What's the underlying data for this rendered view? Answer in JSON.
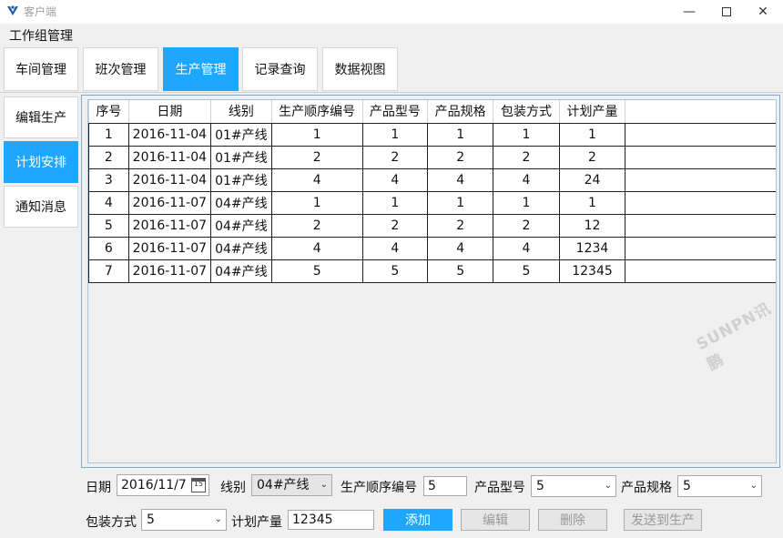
{
  "window": {
    "title": "客户端"
  },
  "header": {
    "title": "工作组管理"
  },
  "top_tabs": [
    {
      "label": "车间管理",
      "active": false
    },
    {
      "label": "班次管理",
      "active": false
    },
    {
      "label": "生产管理",
      "active": true
    },
    {
      "label": "记录查询",
      "active": false
    },
    {
      "label": "数据视图",
      "active": false
    }
  ],
  "side_nav": [
    {
      "label": "编辑生产",
      "active": false
    },
    {
      "label": "计划安排",
      "active": true
    },
    {
      "label": "通知消息",
      "active": false
    }
  ],
  "table": {
    "columns": [
      "序号",
      "日期",
      "线别",
      "生产顺序编号",
      "产品型号",
      "产品规格",
      "包装方式",
      "计划产量"
    ],
    "rows": [
      [
        "1",
        "2016-11-04",
        "01#产线",
        "1",
        "1",
        "1",
        "1",
        "1"
      ],
      [
        "2",
        "2016-11-04",
        "01#产线",
        "2",
        "2",
        "2",
        "2",
        "2"
      ],
      [
        "3",
        "2016-11-04",
        "01#产线",
        "4",
        "4",
        "4",
        "4",
        "24"
      ],
      [
        "4",
        "2016-11-07",
        "04#产线",
        "1",
        "1",
        "1",
        "1",
        "1"
      ],
      [
        "5",
        "2016-11-07",
        "04#产线",
        "2",
        "2",
        "2",
        "2",
        "12"
      ],
      [
        "6",
        "2016-11-07",
        "04#产线",
        "4",
        "4",
        "4",
        "4",
        "1234"
      ],
      [
        "7",
        "2016-11-07",
        "04#产线",
        "5",
        "5",
        "5",
        "5",
        "12345"
      ]
    ]
  },
  "watermark": "SUNPN讯鹏",
  "form": {
    "date_label": "日期",
    "date_value": "2016/11/7",
    "calendar_day": "15",
    "line_label": "线别",
    "line_value": "04#产线",
    "seq_label": "生产顺序编号",
    "seq_value": "5",
    "model_label": "产品型号",
    "model_value": "5",
    "spec_label": "产品规格",
    "spec_value": "5",
    "pack_label": "包装方式",
    "pack_value": "5",
    "qty_label": "计划产量",
    "qty_value": "12345"
  },
  "buttons": {
    "add": "添加",
    "edit": "编辑",
    "delete": "删除",
    "send": "发送到生产"
  },
  "colors": {
    "accent": "#1ea7ff",
    "grid_border": "#7ea9cc"
  },
  "icons": {
    "app": "app-logo-icon",
    "calendar": "calendar-icon",
    "dropdown": "chevron-down-icon"
  }
}
